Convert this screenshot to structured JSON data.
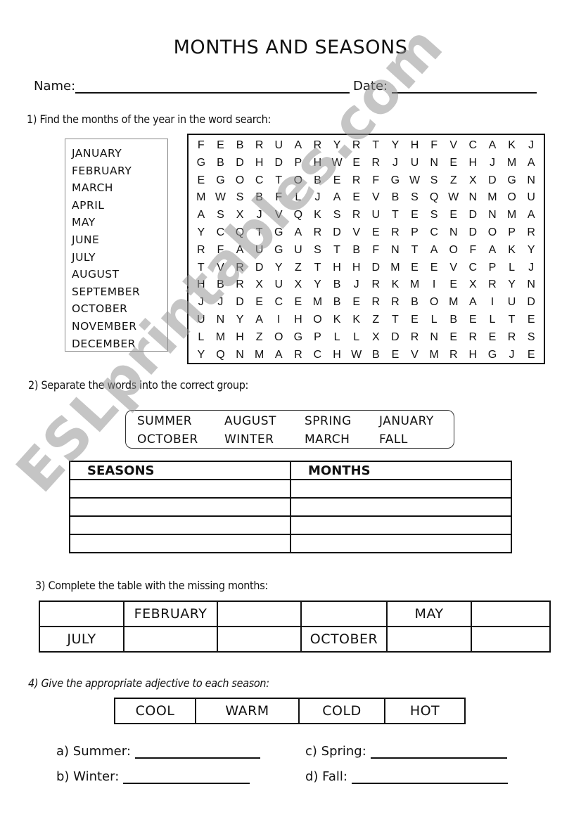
{
  "title": "MONTHS AND SEASONS",
  "header": {
    "name_label": "Name:",
    "date_label": "Date:"
  },
  "section1": {
    "instruction": "1) Find the months of the year in the word search:",
    "word_list": [
      "JANUARY",
      "FEBRUARY",
      "MARCH",
      "APRIL",
      "MAY",
      "JUNE",
      "JULY",
      "AUGUST",
      "SEPTEMBER",
      "OCTOBER",
      "NOVEMBER",
      "DECEMBER"
    ],
    "grid": [
      [
        "F",
        "E",
        "B",
        "R",
        "U",
        "A",
        "R",
        "Y",
        "R",
        "T",
        "Y",
        "H",
        "F",
        "V",
        "C",
        "A",
        "K",
        "J"
      ],
      [
        "G",
        "B",
        "D",
        "H",
        "D",
        "P",
        "H",
        "W",
        "E",
        "R",
        "J",
        "U",
        "N",
        "E",
        "H",
        "J",
        "M",
        "A"
      ],
      [
        "E",
        "G",
        "O",
        "C",
        "T",
        "O",
        "B",
        "E",
        "R",
        "F",
        "G",
        "W",
        "S",
        "Z",
        "X",
        "D",
        "G",
        "N"
      ],
      [
        "M",
        "W",
        "S",
        "B",
        "F",
        "L",
        "J",
        "A",
        "E",
        "V",
        "B",
        "S",
        "Q",
        "W",
        "N",
        "M",
        "O",
        "U"
      ],
      [
        "A",
        "S",
        "X",
        "J",
        "V",
        "Q",
        "K",
        "S",
        "R",
        "U",
        "T",
        "E",
        "S",
        "E",
        "D",
        "N",
        "M",
        "A"
      ],
      [
        "Y",
        "C",
        "Q",
        "T",
        "G",
        "A",
        "R",
        "D",
        "V",
        "E",
        "R",
        "P",
        "C",
        "N",
        "D",
        "O",
        "P",
        "R"
      ],
      [
        "R",
        "F",
        "A",
        "U",
        "G",
        "U",
        "S",
        "T",
        "B",
        "F",
        "N",
        "T",
        "A",
        "O",
        "F",
        "A",
        "K",
        "Y"
      ],
      [
        "T",
        "V",
        "R",
        "D",
        "Y",
        "Z",
        "T",
        "H",
        "H",
        "D",
        "M",
        "E",
        "E",
        "V",
        "C",
        "P",
        "L",
        "J"
      ],
      [
        "H",
        "B",
        "R",
        "X",
        "U",
        "X",
        "Y",
        "B",
        "J",
        "R",
        "K",
        "M",
        "I",
        "E",
        "X",
        "R",
        "Y",
        "N"
      ],
      [
        "J",
        "J",
        "D",
        "E",
        "C",
        "E",
        "M",
        "B",
        "E",
        "R",
        "R",
        "B",
        "O",
        "M",
        "A",
        "I",
        "U",
        "D"
      ],
      [
        "U",
        "N",
        "Y",
        "A",
        "I",
        "H",
        "O",
        "K",
        "K",
        "Z",
        "T",
        "E",
        "L",
        "B",
        "E",
        "L",
        "T",
        "E"
      ],
      [
        "L",
        "M",
        "H",
        "Z",
        "O",
        "G",
        "P",
        "L",
        "L",
        "X",
        "D",
        "R",
        "N",
        "E",
        "R",
        "E",
        "R",
        "S"
      ],
      [
        "Y",
        "Q",
        "N",
        "M",
        "A",
        "R",
        "C",
        "H",
        "W",
        "B",
        "E",
        "V",
        "M",
        "R",
        "H",
        "G",
        "J",
        "E"
      ]
    ]
  },
  "section2": {
    "instruction": "2) Separate the words into the correct group:",
    "word_bank": [
      [
        "SUMMER",
        "AUGUST",
        "SPRING",
        "JANUARY"
      ],
      [
        "OCTOBER",
        "WINTER",
        "MARCH",
        "FALL"
      ]
    ],
    "table_headers": [
      "SEASONS",
      "MONTHS"
    ],
    "blank_rows": 4
  },
  "section3": {
    "instruction": "3) Complete the table with the missing months:",
    "rows": [
      [
        "",
        "FEBRUARY",
        "",
        "",
        "MAY",
        ""
      ],
      [
        "JULY",
        "",
        "",
        "OCTOBER",
        "",
        ""
      ]
    ]
  },
  "section4": {
    "instruction": "4) Give the appropriate adjective to each season:",
    "adjectives": [
      "COOL",
      "WARM",
      "COLD",
      "HOT"
    ],
    "prompts": {
      "a": "a) Summer:",
      "b": "b) Winter:",
      "c": "c) Spring:",
      "d": "d) Fall:"
    }
  },
  "watermark": "ESLprintables.com"
}
